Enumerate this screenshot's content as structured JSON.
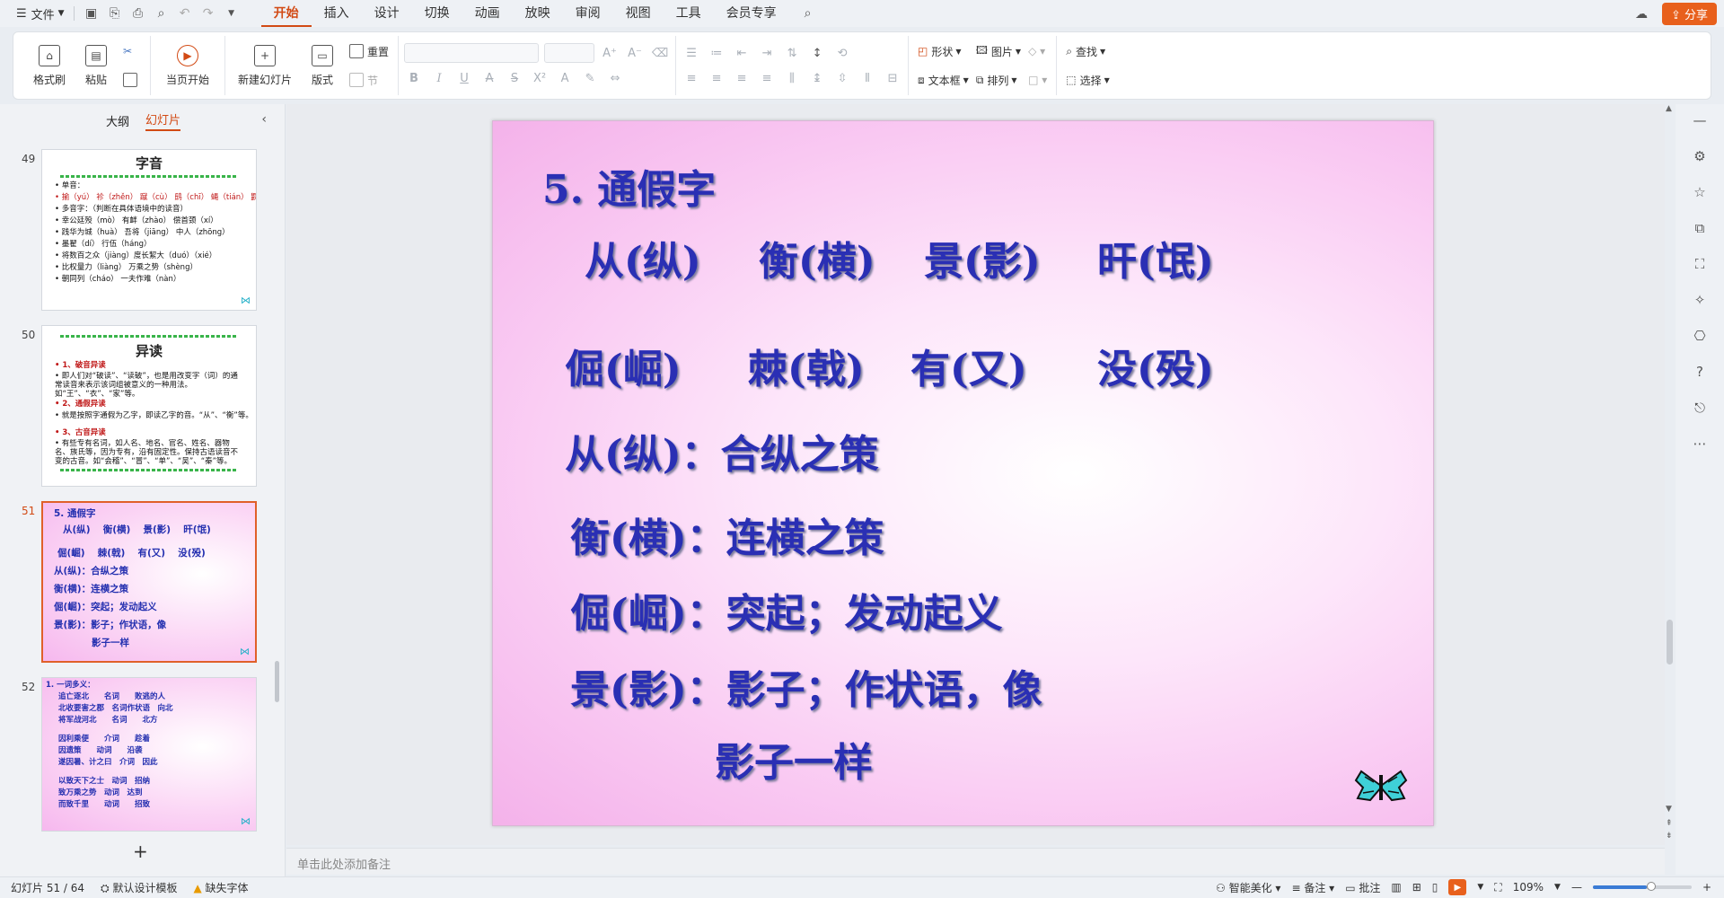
{
  "menubar": {
    "file_label": "文件",
    "tabs": [
      "开始",
      "插入",
      "设计",
      "切换",
      "动画",
      "放映",
      "审阅",
      "视图",
      "工具",
      "会员专享"
    ],
    "active_tab": "开始",
    "share_label": "分享"
  },
  "ribbon": {
    "format_painter": "格式刷",
    "paste": "粘贴",
    "play_from_current": "当页开始",
    "new_slide": "新建幻灯片",
    "layout": "版式",
    "reset": "重置",
    "section": "节",
    "shape": "形状",
    "picture": "图片",
    "textbox": "文本框",
    "arrange": "排列",
    "find": "查找",
    "select": "选择"
  },
  "leftpanel": {
    "tab_outline": "大纲",
    "tab_slides": "幻灯片",
    "slides": [
      {
        "num": "49",
        "title": "字音",
        "lines": [
          "• 单音：",
          "• 揄（yú） 袗（zhěn） 蹴（cù） 鸱（chī） 蝇（tián） 鼲（fún） 媵（téng） 锼（yóu）",
          "• 多音字：（判断在具体语境中的读音）",
          "• 幸公廷殁（mò） 有衅（zhào） 偿首颈（xí）",
          "• 践华为城（huà） 吾将（jiāng） 中人（zhōng）",
          "• 墨翟（dí） 行伍（háng）",
          "• 将数百之众（jiàng）度长絜大（duó）（xié）",
          "• 比权量力（liàng） 万乘之势（shèng）",
          "• 朝同列（cháo） 一夫作难（nàn）"
        ]
      },
      {
        "num": "50",
        "title": "异读",
        "lines": [
          "• 1、破音异读",
          "• 即人们对“破读”、“读破”，也是用改变字（词）的通常读音来表示该词组被意义的一种用法。如“王”、“衣”、“家”等。",
          "• 2、通假异读",
          "• 就是按照字通假为乙字，即读乙字的音。“从”、“衡”等。",
          "• 3、古音异读",
          "• 有些专有名词，如人名、地名、官名、姓名、器物名、族氏等，因为专有，沿有固定性。保持古语读音不变的古音。如“会稽”、“冒”、“单”、“吴”、“秦”等。"
        ]
      },
      {
        "num": "51",
        "lines": [
          "5. 通假字",
          "从(纵)　 衡(横)　 景(影)　 旰(氓)",
          "倔(崛)　 棘(戟)　 有(又)　 没(殁)",
          "从(纵)：合纵之策",
          "衡(横)：连横之策",
          "倔(崛)：突起；发动起义",
          "景(影)：影子；作状语，像",
          "　　　　影子一样"
        ]
      },
      {
        "num": "52",
        "lines": [
          "1. 一词多义：",
          "追亡逐北　　名词　　败逃的人",
          "北收要害之郡　名词作状语　向北",
          "将军战河北　　名词　　北方",
          "因利乘便　　介词　　趁着",
          "因遗策　　动词　　沿袭",
          "遂因暑、计之曰　介词　因此",
          "以致天下之士　动词　招纳",
          "致万乘之势　动词　达到",
          "而致千里　　动词　　招致"
        ]
      }
    ]
  },
  "slide": {
    "title": "5. 通假字",
    "row1": [
      "从(纵)",
      "衡(横)",
      "景(影)",
      "旰(氓)"
    ],
    "row2": [
      "倔(崛)",
      "棘(戟)",
      "有(又)",
      "没(殁)"
    ],
    "line1": "从(纵)：合纵之策",
    "line2": "衡(横)：连横之策",
    "line3": "倔(崛)：突起；发动起义",
    "line4": "景(影)：影子；作状语，像",
    "line5": "影子一样"
  },
  "notes_placeholder": "单击此处添加备注",
  "statusbar": {
    "slide_counter": "幻灯片 51 / 64",
    "template": "默认设计模板",
    "missing_font": "缺失字体",
    "beautify": "智能美化",
    "notes": "备注",
    "comments": "批注",
    "zoom": "109%"
  }
}
